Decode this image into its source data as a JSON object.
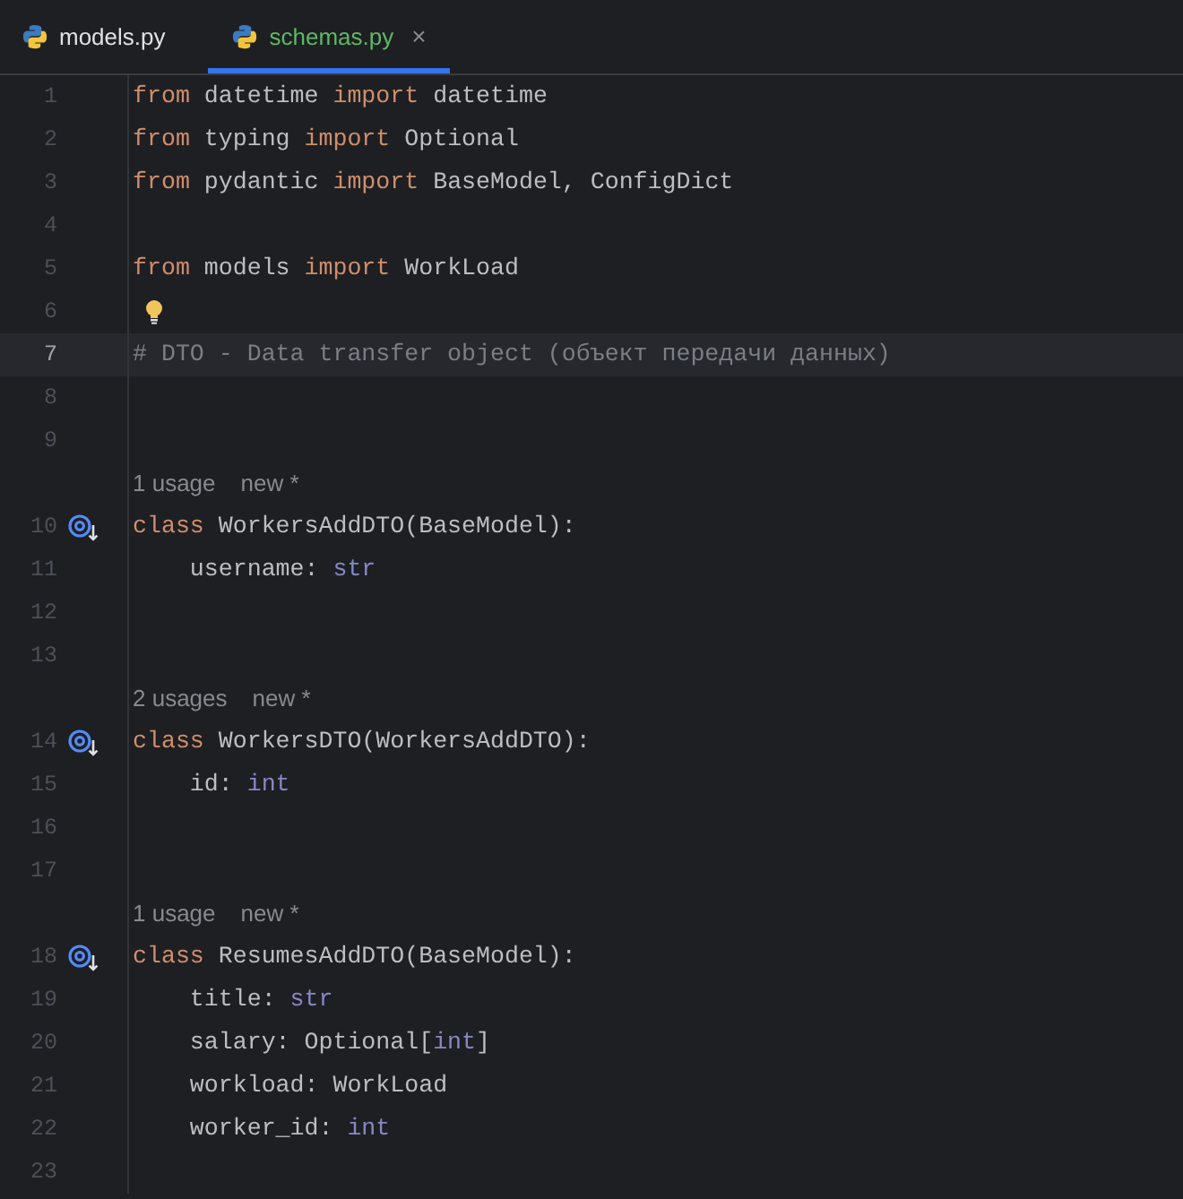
{
  "tabs": [
    {
      "label": "models.py",
      "selected": false
    },
    {
      "label": "schemas.py",
      "selected": true,
      "close": "×"
    }
  ],
  "lines": [
    {
      "kind": "code",
      "number": "1",
      "tokens": [
        {
          "text": "from",
          "kind": "keyword"
        },
        {
          "text": " datetime ",
          "kind": "plain"
        },
        {
          "text": "import",
          "kind": "keyword"
        },
        {
          "text": " datetime",
          "kind": "plain"
        }
      ]
    },
    {
      "kind": "code",
      "number": "2",
      "tokens": [
        {
          "text": "from",
          "kind": "keyword"
        },
        {
          "text": " typing ",
          "kind": "plain"
        },
        {
          "text": "import",
          "kind": "keyword"
        },
        {
          "text": " Optional",
          "kind": "plain"
        }
      ]
    },
    {
      "kind": "code",
      "number": "3",
      "tokens": [
        {
          "text": "from",
          "kind": "keyword"
        },
        {
          "text": " pydantic ",
          "kind": "plain"
        },
        {
          "text": "import",
          "kind": "keyword"
        },
        {
          "text": " BaseModel, ConfigDict",
          "kind": "plain"
        }
      ]
    },
    {
      "kind": "code",
      "number": "4"
    },
    {
      "kind": "code",
      "number": "5",
      "tokens": [
        {
          "text": "from",
          "kind": "keyword"
        },
        {
          "text": " models ",
          "kind": "plain"
        },
        {
          "text": "import",
          "kind": "keyword"
        },
        {
          "text": " WorkLoad",
          "kind": "plain"
        }
      ]
    },
    {
      "kind": "code",
      "number": "6",
      "bulb": true
    },
    {
      "kind": "code",
      "number": "7",
      "current": true,
      "tokens": [
        {
          "text": "# DTO - Data transfer object (объект передачи данных)",
          "kind": "comment"
        }
      ]
    },
    {
      "kind": "code",
      "number": "8"
    },
    {
      "kind": "code",
      "number": "9"
    },
    {
      "kind": "hint",
      "usages": "1 usage",
      "note": "new *"
    },
    {
      "kind": "code",
      "number": "10",
      "implemented": true,
      "tokens": [
        {
          "text": "class",
          "kind": "keyword"
        },
        {
          "text": " WorkersAddDTO(BaseModel):",
          "kind": "plain"
        }
      ]
    },
    {
      "kind": "code",
      "number": "11",
      "tokens": [
        {
          "text": "    username: ",
          "kind": "plain"
        },
        {
          "text": "str",
          "kind": "builtin"
        }
      ]
    },
    {
      "kind": "code",
      "number": "12"
    },
    {
      "kind": "code",
      "number": "13"
    },
    {
      "kind": "hint",
      "usages": "2 usages",
      "note": "new *"
    },
    {
      "kind": "code",
      "number": "14",
      "implemented": true,
      "tokens": [
        {
          "text": "class",
          "kind": "keyword"
        },
        {
          "text": " WorkersDTO(WorkersAddDTO):",
          "kind": "plain"
        }
      ]
    },
    {
      "kind": "code",
      "number": "15",
      "tokens": [
        {
          "text": "    id: ",
          "kind": "plain"
        },
        {
          "text": "int",
          "kind": "builtin"
        }
      ]
    },
    {
      "kind": "code",
      "number": "16"
    },
    {
      "kind": "code",
      "number": "17"
    },
    {
      "kind": "hint",
      "usages": "1 usage",
      "note": "new *"
    },
    {
      "kind": "code",
      "number": "18",
      "implemented": true,
      "tokens": [
        {
          "text": "class",
          "kind": "keyword"
        },
        {
          "text": " ResumesAddDTO(BaseModel):",
          "kind": "plain"
        }
      ]
    },
    {
      "kind": "code",
      "number": "19",
      "tokens": [
        {
          "text": "    title: ",
          "kind": "plain"
        },
        {
          "text": "str",
          "kind": "builtin"
        }
      ]
    },
    {
      "kind": "code",
      "number": "20",
      "tokens": [
        {
          "text": "    salary: Optional[",
          "kind": "plain"
        },
        {
          "text": "int",
          "kind": "builtin"
        },
        {
          "text": "]",
          "kind": "plain"
        }
      ]
    },
    {
      "kind": "code",
      "number": "21",
      "tokens": [
        {
          "text": "    workload: WorkLoad",
          "kind": "plain"
        }
      ]
    },
    {
      "kind": "code",
      "number": "22",
      "tokens": [
        {
          "text": "    worker_id: ",
          "kind": "plain"
        },
        {
          "text": "int",
          "kind": "builtin"
        }
      ]
    },
    {
      "kind": "code",
      "number": "23"
    }
  ]
}
